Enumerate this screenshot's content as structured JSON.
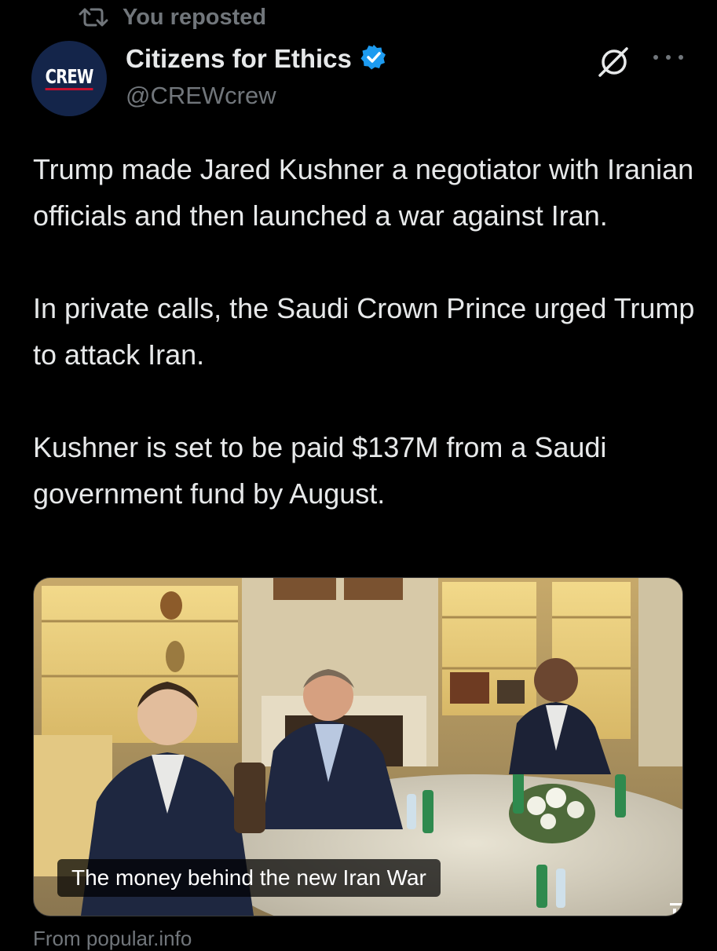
{
  "repost": {
    "label": "You reposted",
    "icon": "repost-icon"
  },
  "author": {
    "avatar_text": "CREW",
    "name": "Citizens for Ethics",
    "handle": "@CREWcrew",
    "verified_icon": "verified-badge-icon"
  },
  "actions": {
    "grok_icon": "grok-icon",
    "more_icon": "more-icon"
  },
  "tweet": {
    "paragraphs": [
      "Trump made Jared Kushner a negotiator with Iranian officials and then launched a war against Iran.",
      "In private calls, the Saudi Crown Prince urged Trump to attack Iran.",
      "Kushner is set to be paid $137M from a Saudi government fund by August."
    ]
  },
  "media": {
    "caption": "The money behind the new Iran War"
  },
  "source": {
    "label": "From popular.info"
  },
  "colors": {
    "background": "#000000",
    "text": "#e7e9ea",
    "muted": "#71767b",
    "verified": "#1d9bf0",
    "avatar_bg": "#14254a"
  }
}
